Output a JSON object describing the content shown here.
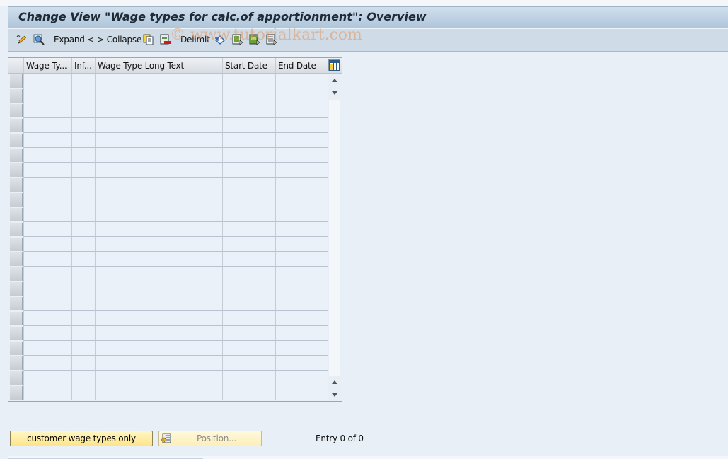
{
  "window": {
    "title": "Change View \"Wage types for calc.of apportionment\": Overview"
  },
  "toolbar": {
    "items": [
      {
        "id": "display-change",
        "icon": "pencil-glasses-icon",
        "label": ""
      },
      {
        "id": "find",
        "icon": "magnifier-icon",
        "label": ""
      },
      {
        "id": "expand-collapse",
        "icon": "",
        "label": "Expand <-> Collapse"
      },
      {
        "id": "copy-as",
        "icon": "copy-icon",
        "label": ""
      },
      {
        "id": "delete",
        "icon": "delete-row-icon",
        "label": ""
      },
      {
        "id": "delimit",
        "icon": "",
        "label": "Delimit"
      },
      {
        "id": "undo-change",
        "icon": "undo-icon",
        "label": ""
      },
      {
        "id": "select-all",
        "icon": "select-all-icon",
        "label": ""
      },
      {
        "id": "select-block",
        "icon": "select-block-icon",
        "label": ""
      },
      {
        "id": "deselect-all",
        "icon": "deselect-all-icon",
        "label": ""
      }
    ],
    "watermark": "© www.tutorialkart.com"
  },
  "table": {
    "columns": [
      {
        "key": "wage_type",
        "label": "Wage Ty..."
      },
      {
        "key": "inf",
        "label": "Inf..."
      },
      {
        "key": "long_text",
        "label": "Wage Type Long Text"
      },
      {
        "key": "start_date",
        "label": "Start Date"
      },
      {
        "key": "end_date",
        "label": "End Date"
      }
    ],
    "rows": [],
    "visible_empty_rows": 22,
    "column_settings_icon": "table-settings-icon"
  },
  "footer": {
    "customer_button_label": "customer wage types only",
    "position_button_label": "Position...",
    "entry_text": "Entry 0 of 0"
  }
}
